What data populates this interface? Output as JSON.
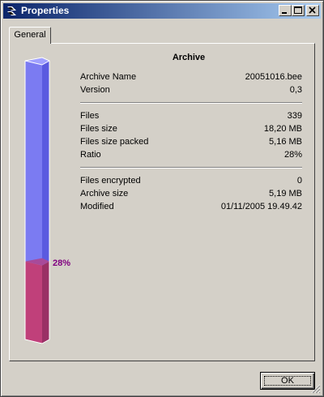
{
  "window": {
    "title": "Properties",
    "icon": "app-icon",
    "controls": {
      "minimize": "minimize-icon",
      "maximize": "maximize-icon",
      "close": "close-icon"
    }
  },
  "tabs": [
    {
      "label": "General",
      "selected": true
    }
  ],
  "archive": {
    "heading": "Archive",
    "ratio_fraction": 0.28,
    "gauge_label": "28%",
    "rows": [
      {
        "label": "Archive Name",
        "value": "20051016.bee"
      },
      {
        "label": "Version",
        "value": "0,3"
      },
      {
        "label": "Files",
        "value": "339"
      },
      {
        "label": "Files size",
        "value": "18,20 MB"
      },
      {
        "label": "Files size packed",
        "value": "5,16 MB"
      },
      {
        "label": "Ratio",
        "value": "28%"
      },
      {
        "label": "Files encrypted",
        "value": "0"
      },
      {
        "label": "Archive size",
        "value": "5,19 MB"
      },
      {
        "label": "Modified",
        "value": "01/11/2005 19.49.42"
      }
    ]
  },
  "colors": {
    "gauge_empty": "#7b7bf2",
    "gauge_filled": "#c0407a",
    "gauge_label": "#800080",
    "titlebar_start": "#0a246a",
    "titlebar_end": "#a6caf0"
  },
  "buttons": {
    "ok": "OK"
  }
}
